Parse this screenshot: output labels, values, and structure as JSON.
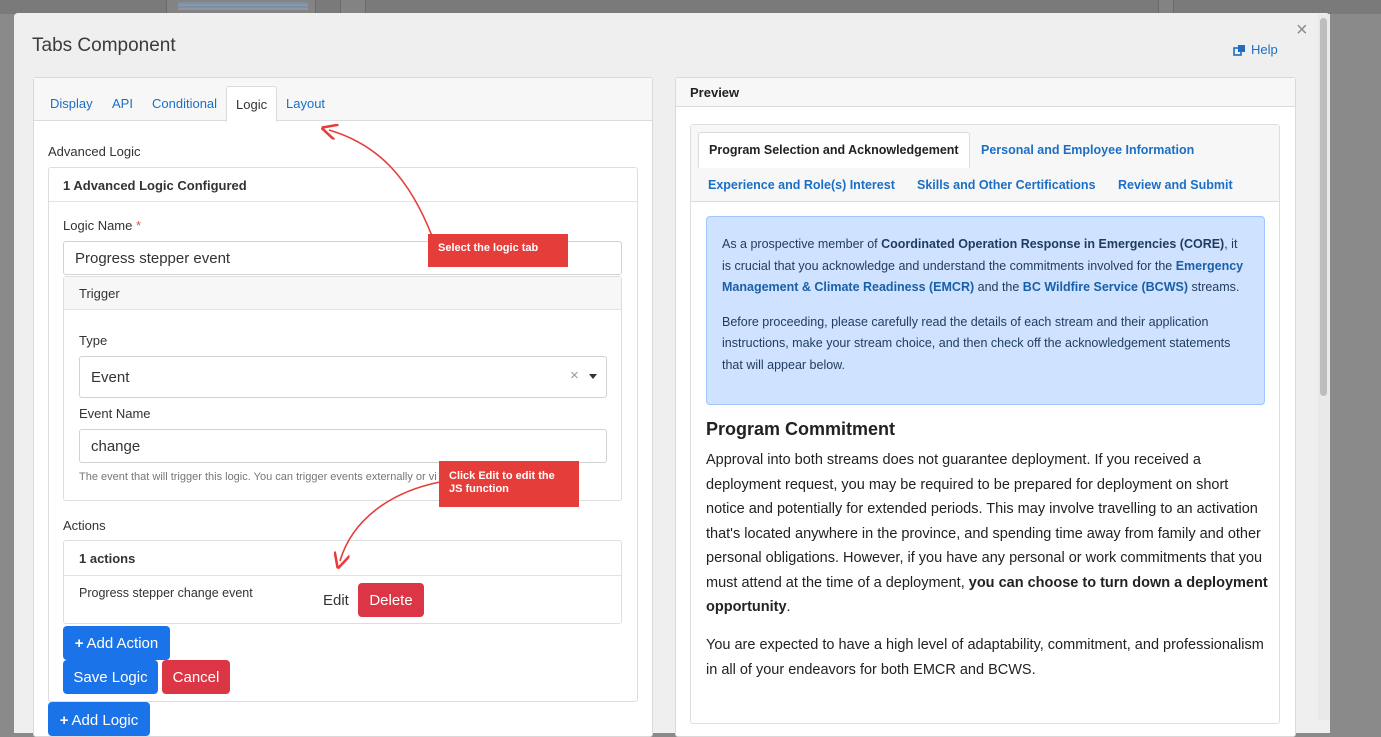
{
  "modal": {
    "title": "Tabs Component",
    "help_label": "Help",
    "close_glyph": "×"
  },
  "editor": {
    "tabs": [
      {
        "label": "Display"
      },
      {
        "label": "API"
      },
      {
        "label": "Conditional"
      },
      {
        "label": "Logic"
      },
      {
        "label": "Layout"
      }
    ],
    "active_tab": "Logic",
    "advanced_logic_label": "Advanced Logic",
    "configured_header": "1 Advanced Logic Configured",
    "logic_name_label": "Logic Name",
    "required_mark": "*",
    "logic_name_value": "Progress stepper event",
    "trigger_header": "Trigger",
    "type_label": "Type",
    "type_value": "Event",
    "clear_glyph": "×",
    "event_name_label": "Event Name",
    "event_name_value": "change",
    "event_hint": "The event that will trigger this logic. You can trigger events externally or vi",
    "actions_label": "Actions",
    "actions_header": "1 actions",
    "action_name": "Progress stepper change event",
    "edit_label": "Edit",
    "delete_label": "Delete",
    "add_action_label": "Add Action",
    "save_logic_label": "Save Logic",
    "cancel_label": "Cancel",
    "add_logic_label": "Add Logic"
  },
  "callouts": {
    "logic_tab": "Select the logic tab",
    "edit_js_line1": "Click Edit to edit the",
    "edit_js_line2": "JS function"
  },
  "preview": {
    "header": "Preview",
    "tabs": [
      {
        "label": "Program Selection and Acknowledgement"
      },
      {
        "label": "Personal and Employee Information"
      },
      {
        "label": "Experience and Role(s) Interest"
      },
      {
        "label": "Skills and Other Certifications"
      },
      {
        "label": "Review and Submit"
      }
    ],
    "alert": {
      "p1_a": "As a prospective member of ",
      "p1_b": "Coordinated Operation Response in Emergencies (CORE)",
      "p1_c": ", it is crucial that you acknowledge and understand the commitments involved for the ",
      "p1_d": "Emergency Management & Climate Readiness (EMCR)",
      "p1_e": " and the ",
      "p1_f": "BC Wildfire Service (BCWS)",
      "p1_g": " streams.",
      "p2": "Before proceeding, please carefully read the details of each stream and their application instructions, make your stream choice, and then check off the acknowledgement statements that will appear below."
    },
    "heading": "Program Commitment",
    "para1_a": "Approval into both streams does not guarantee deployment. If you received a deployment request, you may be required to be prepared for deployment on short notice and potentially for extended periods. This may involve travelling to an activation that's located anywhere in the province, and spending time away from family and other personal obligations. However, if you have any personal or work commitments that you must attend at the time of a deployment, ",
    "para1_b": "you can choose to turn down a deployment opportunity",
    "para1_c": ".",
    "para2": "You are expected to have a high level of adaptability, commitment, and professionalism in all of your endeavors for both EMCR and BCWS."
  },
  "colors": {
    "accent": "#1a73e8",
    "danger": "#dc3545",
    "callout": "#e53d3a",
    "alert_bg": "#cfe2ff"
  }
}
